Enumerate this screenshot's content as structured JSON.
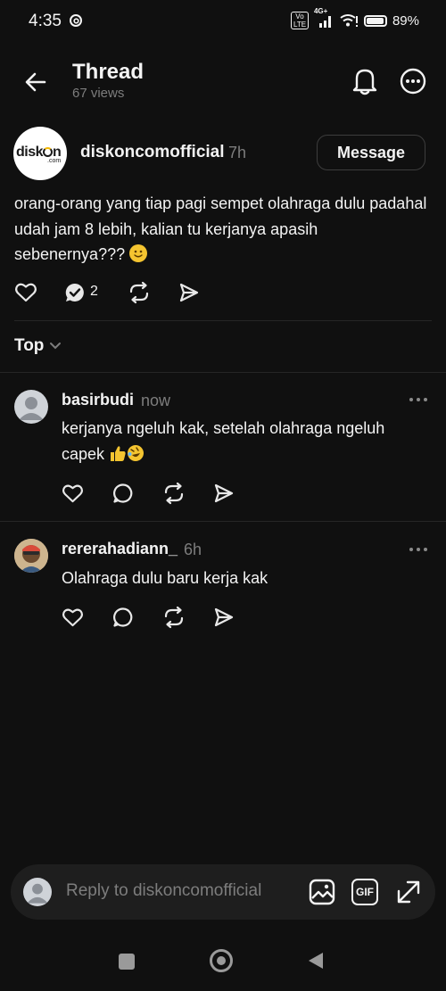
{
  "status_bar": {
    "time": "4:35",
    "volte": "Vo LTE",
    "network": "4G+",
    "battery": "89%"
  },
  "header": {
    "title": "Thread",
    "views": "67 views"
  },
  "post": {
    "logo_text": "disk",
    "logo_text2": "n",
    "logo_sub": ".com",
    "username": "diskoncomofficial",
    "time": "7h",
    "message_label": "Message",
    "text": "orang-orang yang tiap pagi sempet olahraga dulu padahal udah jam 8 lebih, kalian tu kerjanya apasih sebenernya???",
    "reply_count": "2"
  },
  "sort": {
    "label": "Top"
  },
  "comments": [
    {
      "username": "basirbudi",
      "time": "now",
      "text": "kerjanya ngeluh kak, setelah olahraga ngeluh capek"
    },
    {
      "username": "rererahadiann_",
      "time": "6h",
      "text": "Olahraga dulu baru kerja kak"
    }
  ],
  "reply_bar": {
    "placeholder": "Reply to diskoncomofficial",
    "gif_label": "GIF"
  },
  "colors": {
    "background": "#101010",
    "text": "#f3f3f3",
    "muted": "#7d7d7d",
    "divider": "#262626"
  }
}
